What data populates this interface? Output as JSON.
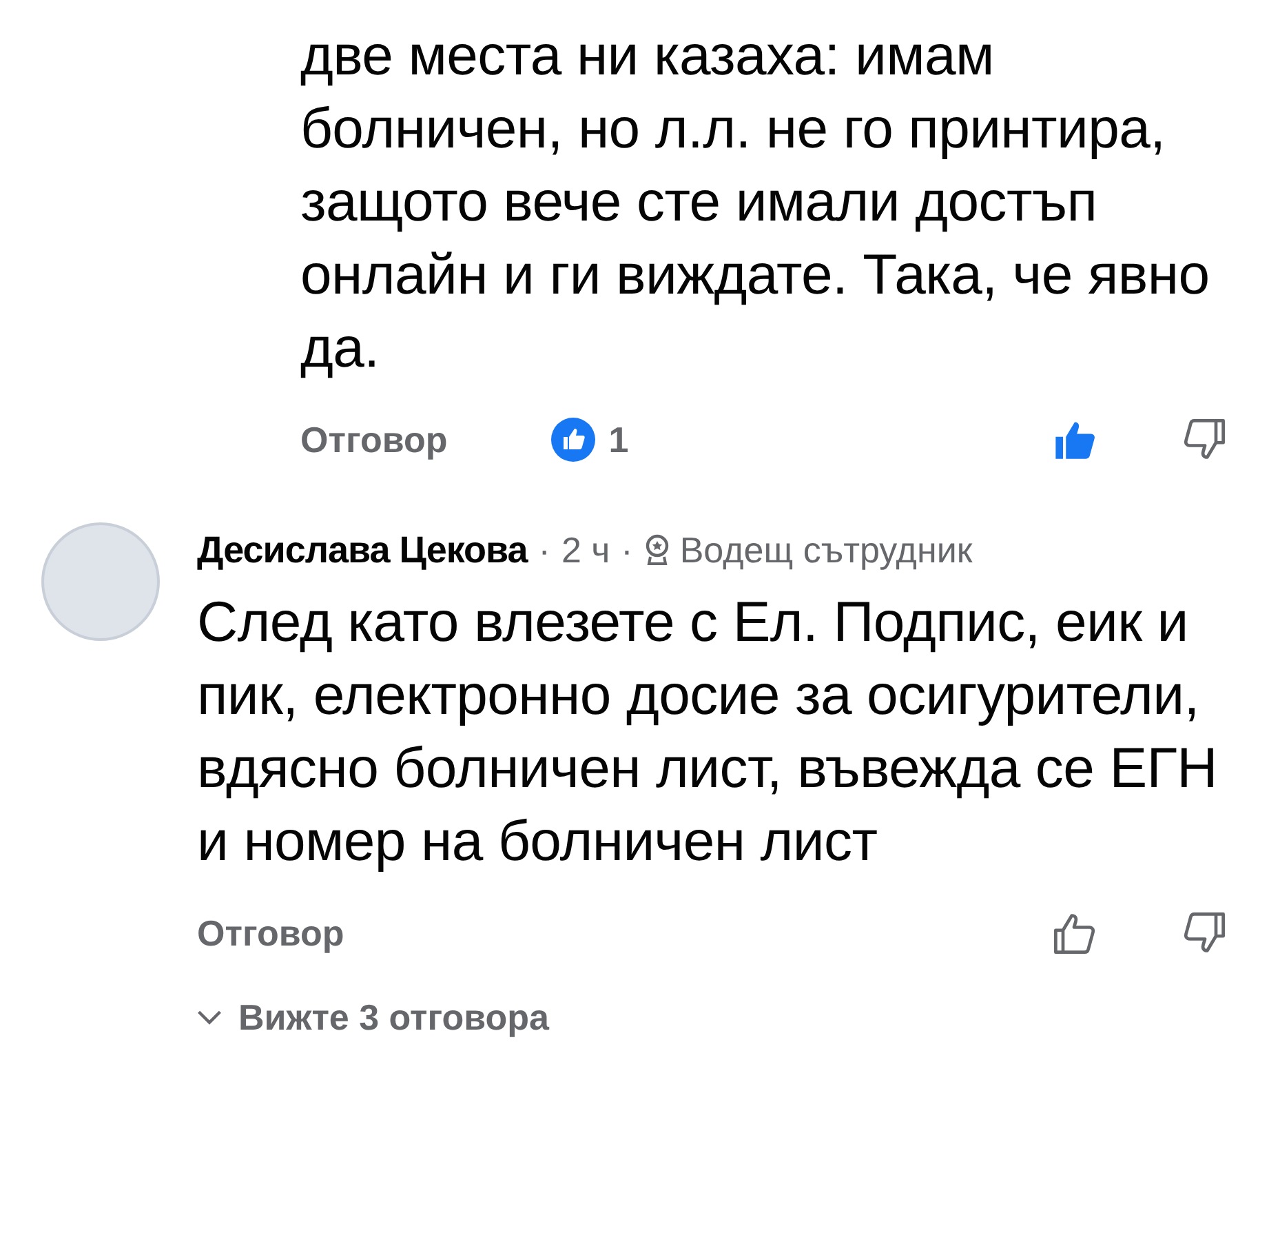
{
  "comments": [
    {
      "text": "две места ни казаха: имам болничен, но л.л. не го принтира, защото вече сте имали достъп онлайн и ги виждате. Така, че явно да.",
      "reply": "Отговор",
      "reaction_count": "1",
      "liked": true
    },
    {
      "author": "Десислава Цекова",
      "separator": "·",
      "time": "2 ч",
      "badge": "Водещ сътрудник",
      "text": "След като влезете с Ел. Подпис, еик и пик, електронно досие за осигурители, вдясно болничен лист, въвежда се ЕГН и номер на болничен лист",
      "reply": "Отговор",
      "liked": false,
      "replies_link": "Вижте 3 отговора"
    }
  ]
}
